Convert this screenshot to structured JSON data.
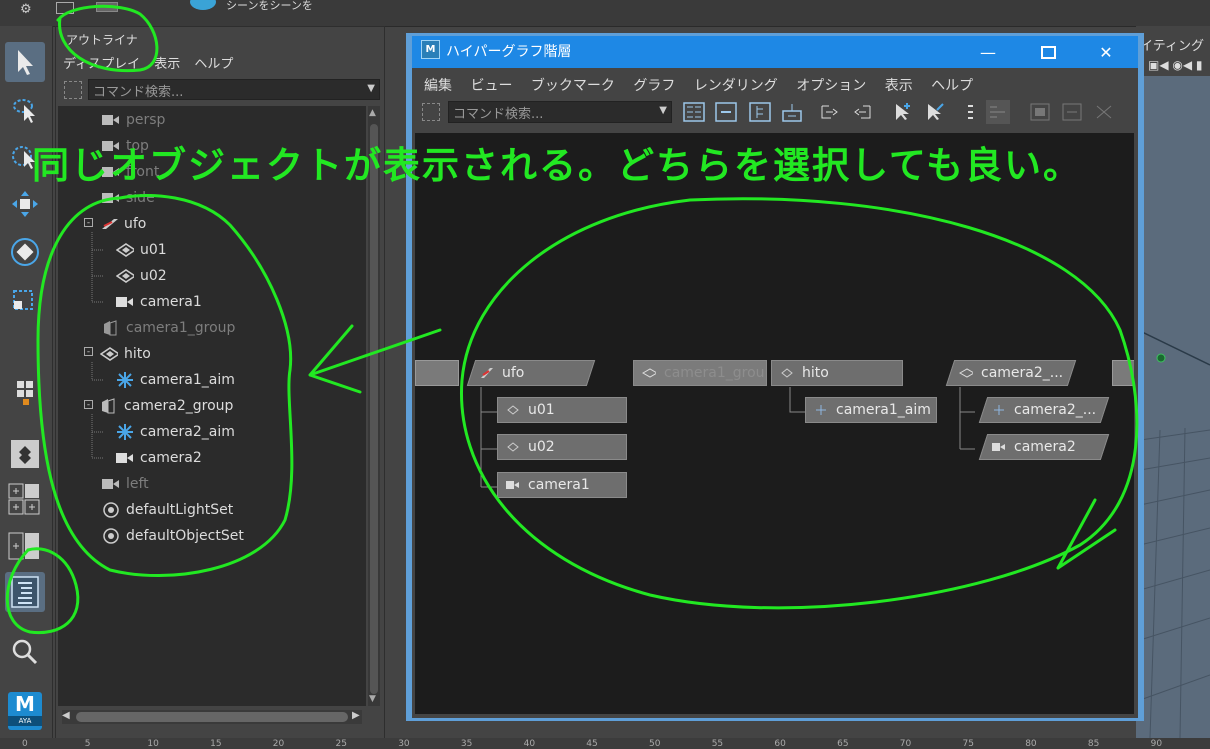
{
  "top": {
    "menu_label": "シーンをシーンを"
  },
  "outliner": {
    "title": "アウトライナ",
    "menu": [
      "ディスプレイ",
      "表示",
      "ヘルプ"
    ],
    "search_placeholder": "コマンド検索...",
    "items": [
      {
        "label": "persp",
        "icon": "camera-icon",
        "dim": true
      },
      {
        "label": "top",
        "icon": "camera-icon",
        "dim": true
      },
      {
        "label": "front",
        "icon": "camera-icon",
        "dim": true
      },
      {
        "label": "side",
        "icon": "camera-icon",
        "dim": true
      },
      {
        "label": "ufo",
        "icon": "ufo-icon",
        "dim": false
      },
      {
        "label": "u01",
        "icon": "transform-icon",
        "dim": false
      },
      {
        "label": "u02",
        "icon": "transform-icon",
        "dim": false
      },
      {
        "label": "camera1",
        "icon": "camera-icon",
        "dim": false
      },
      {
        "label": "camera1_group",
        "icon": "group-icon",
        "dim": true
      },
      {
        "label": "hito",
        "icon": "transform-icon",
        "dim": false
      },
      {
        "label": "camera1_aim",
        "icon": "aim-icon",
        "dim": false
      },
      {
        "label": "camera2_group",
        "icon": "group-icon",
        "dim": false
      },
      {
        "label": "camera2_aim",
        "icon": "aim-icon",
        "dim": false
      },
      {
        "label": "camera2",
        "icon": "camera-icon",
        "dim": false
      },
      {
        "label": "left",
        "icon": "camera-icon",
        "dim": true
      },
      {
        "label": "defaultLightSet",
        "icon": "set-icon",
        "dim": false
      },
      {
        "label": "defaultObjectSet",
        "icon": "set-icon",
        "dim": false
      }
    ]
  },
  "hypergraph": {
    "title": "ハイパーグラフ階層",
    "logo": "M",
    "menu": [
      "編集",
      "ビュー",
      "ブックマーク",
      "グラフ",
      "レンダリング",
      "オプション",
      "表示",
      "ヘルプ"
    ],
    "search_placeholder": "コマンド検索...",
    "nodes": {
      "ufo": "ufo",
      "u01": "u01",
      "u02": "u02",
      "camera1": "camera1",
      "camera1_group": "camera1_grou",
      "hito": "hito",
      "camera1_aim": "camera1_aim",
      "camera2_group": "camera2_...",
      "camera2_aim": "camera2_...",
      "camera2": "camera2"
    }
  },
  "viewport": {
    "menu_label": "イティング"
  },
  "annotation": {
    "text": "同じオブジェクトが表示される。どちらを選択しても良い。"
  },
  "ruler": {
    "ticks": [
      "0",
      "5",
      "10",
      "15",
      "20",
      "25",
      "30",
      "35",
      "40",
      "45",
      "50",
      "55",
      "60",
      "65",
      "70",
      "75",
      "80",
      "85",
      "90"
    ]
  },
  "toolbox": {
    "logo_letter": "M",
    "logo_sub": "AYA"
  },
  "colors": {
    "annotation": "#22e822",
    "titlebar": "#1e88e5",
    "selected_tool": "#5a6e82"
  }
}
